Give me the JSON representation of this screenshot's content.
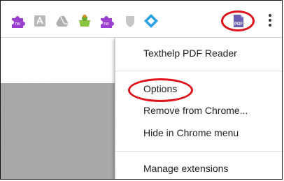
{
  "toolbar": {
    "extensions": [
      {
        "icon": "read-write-purple-icon",
        "label": "rw",
        "color": "#9b3fd1"
      },
      {
        "icon": "adobe-pdf-gray-icon",
        "label": "",
        "color": "#b8b8b8"
      },
      {
        "icon": "google-drive-gray-icon",
        "label": "",
        "color": "#b0b0b0"
      },
      {
        "icon": "green-bag-icon",
        "label": "",
        "color": "#8ac53f"
      },
      {
        "icon": "read-write-purple-icon",
        "label": "rw",
        "color": "#9b3fd1"
      },
      {
        "icon": "gray-shield-icon",
        "label": "",
        "color": "#c7c7c7"
      },
      {
        "icon": "blue-diamond-icon",
        "label": "",
        "color": "#2a9ee8"
      },
      {
        "icon": "texthelp-pdf-icon",
        "label": "PDF",
        "color": "#6b5fb0"
      }
    ],
    "more_menu_icon": "vertical-dots-icon"
  },
  "context_menu": {
    "items": [
      {
        "label": "Texthelp PDF Reader"
      },
      {
        "label": "Options"
      },
      {
        "label": "Remove from Chrome..."
      },
      {
        "label": "Hide in Chrome menu"
      },
      {
        "label": "Manage extensions"
      }
    ]
  },
  "annotation_color": "#e0121b"
}
